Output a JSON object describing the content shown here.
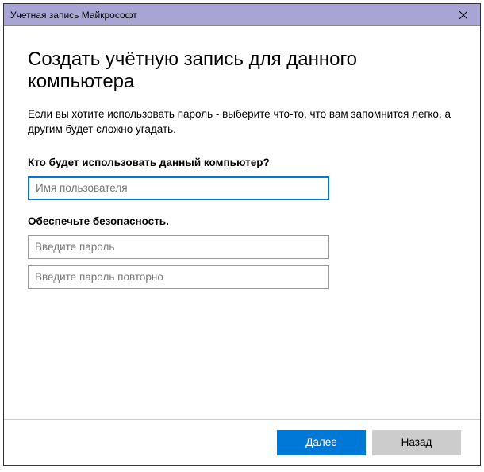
{
  "titlebar": {
    "title": "Учетная запись Майкрософт"
  },
  "heading": "Создать учётную запись для данного компьютера",
  "description": "Если вы хотите использовать пароль - выберите что-то, что вам запомнится легко, а другим будет сложно угадать.",
  "section1": {
    "label": "Кто будет использовать данный компьютер?",
    "username_placeholder": "Имя пользователя"
  },
  "section2": {
    "label": "Обеспечьте безопасность.",
    "password_placeholder": "Введите пароль",
    "password_confirm_placeholder": "Введите пароль повторно"
  },
  "footer": {
    "next": "Далее",
    "back": "Назад"
  }
}
